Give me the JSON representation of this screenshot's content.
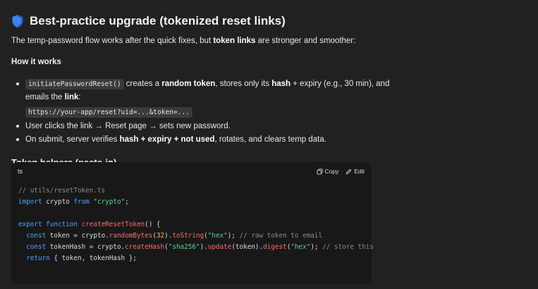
{
  "heading": {
    "title": "Best-practice upgrade (tokenized reset links)"
  },
  "intro": {
    "text_before": "The temp-password flow works after the quick fixes, but ",
    "bold": "token links",
    "text_after": " are stronger and smoother:"
  },
  "how": {
    "title": "How it works",
    "b1": {
      "code": "initiatePasswordReset()",
      "t1": " creates a ",
      "b1": "random token",
      "t2": ", stores only its ",
      "b2": "hash",
      "t3": " + expiry (e.g., 30 min), and emails the ",
      "b3": "link",
      "t4": ":",
      "url": "https://your-app/reset?uid=...&token=..."
    },
    "b2": {
      "text": "User clicks the link → Reset page → sets new password."
    },
    "b3": {
      "t1": "On submit, server verifies ",
      "b1": "hash + expiry + not used",
      "t2": ", rotates, and clears temp data."
    }
  },
  "helpers": {
    "title": "Token helpers (paste-in)"
  },
  "codeblock": {
    "lang": "ts",
    "copy_label": "Copy",
    "edit_label": "Edit",
    "l1": "// utils/resetToken.ts",
    "l2_kw": "import",
    "l2_id": " crypto ",
    "l2_from": "from",
    "l2_str": "\"crypto\"",
    "l2_end": ";",
    "l4_kw": "export function",
    "l4_fn": "createResetToken",
    "l4_end": "() {",
    "l5_kw": "const",
    "l5_a": " token = crypto.",
    "l5_fn": "randomBytes",
    "l5_p1": "(",
    "l5_num": "32",
    "l5_p2": ").",
    "l5_fn2": "toString",
    "l5_p3": "(",
    "l5_str": "\"hex\"",
    "l5_p4": "); ",
    "l5_c": "// raw token to email",
    "l6_kw": "const",
    "l6_a": " tokenHash = crypto.",
    "l6_fn": "createHash",
    "l6_p1": "(",
    "l6_str": "\"sha256\"",
    "l6_p2": ").",
    "l6_fn2": "update",
    "l6_p3": "(token).",
    "l6_fn3": "digest",
    "l6_p4": "(",
    "l6_str2": "\"hex\"",
    "l6_p5": "); ",
    "l6_c": "// store this",
    "l7_kw": "return",
    "l7_a": " { token, tokenHash };"
  },
  "colors": {
    "background": "#212121",
    "code_background": "#181818",
    "keyword": "#4fa3ff",
    "string": "#58d68d",
    "function": "#ff6b6b",
    "number": "#f2c14e",
    "shield": "#3b82f6"
  }
}
